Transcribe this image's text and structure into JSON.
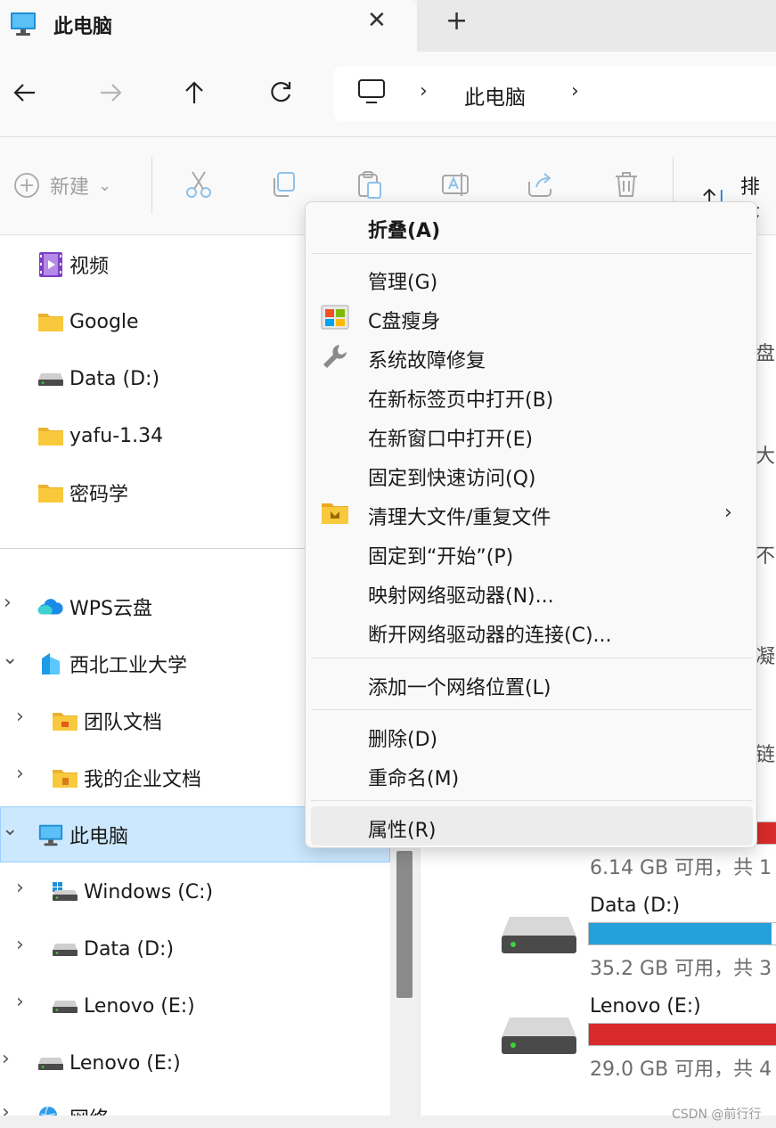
{
  "tab": {
    "title": "此电脑",
    "close_glyph": "✕",
    "new_glyph": "+"
  },
  "address": {
    "chevron": "›",
    "location": "此电脑"
  },
  "command_bar": {
    "new_label": "新建",
    "new_chevron": "⌄",
    "sort_label": "排序"
  },
  "nav_pane": {
    "quick_access": [
      {
        "label": "视频",
        "icon": "video-folder-icon"
      },
      {
        "label": "Google",
        "icon": "folder-icon"
      },
      {
        "label": "Data (D:)",
        "icon": "drive-icon"
      },
      {
        "label": "yafu-1.34",
        "icon": "folder-icon"
      },
      {
        "label": "密码学",
        "icon": "folder-icon"
      }
    ],
    "tree": [
      {
        "label": "WPS云盘",
        "icon": "cloud-icon",
        "chevron": "›"
      },
      {
        "label": "西北工业大学",
        "icon": "org-icon",
        "chevron": "⌄"
      },
      {
        "label": "团队文档",
        "icon": "team-folder-icon",
        "chevron": "›"
      },
      {
        "label": "我的企业文档",
        "icon": "enterprise-folder-icon",
        "chevron": "›"
      },
      {
        "label": "此电脑",
        "icon": "pc-icon",
        "chevron": "⌄"
      },
      {
        "label": "Windows (C:)",
        "icon": "windows-drive-icon",
        "chevron": "›"
      },
      {
        "label": "Data (D:)",
        "icon": "drive-icon",
        "chevron": "›"
      },
      {
        "label": "Lenovo  (E:)",
        "icon": "drive-icon",
        "chevron": "›"
      },
      {
        "label": "Lenovo  (E:)",
        "icon": "drive-icon",
        "chevron": "›"
      },
      {
        "label": "网络",
        "icon": "network-icon",
        "chevron": "›"
      }
    ]
  },
  "content": {
    "fragments": [
      "盘",
      "大",
      "不",
      "凝",
      "链"
    ],
    "drives": [
      {
        "space": "6.14 GB 可用，共 1",
        "bar_color": "#d92b2b",
        "fill": 0.97
      },
      {
        "name": "Data (D:)",
        "space": "35.2 GB 可用，共 3",
        "bar_color": "#26a0da",
        "fill": 0.9
      },
      {
        "name": "Lenovo  (E:)",
        "space": "29.0 GB 可用，共 4",
        "bar_color": "#d92b2b",
        "fill": 0.95
      }
    ]
  },
  "context_menu": {
    "items": [
      {
        "label": "折叠(A)",
        "bold": true
      },
      {
        "label": "管理(G)"
      },
      {
        "label": "C盘瘦身",
        "icon": "windows-logo-icon"
      },
      {
        "label": "系统故障修复",
        "icon": "wrench-icon"
      },
      {
        "label": "在新标签页中打开(B)"
      },
      {
        "label": "在新窗口中打开(E)"
      },
      {
        "label": "固定到快速访问(Q)"
      },
      {
        "label": "清理大文件/重复文件",
        "icon": "cleanup-folder-icon",
        "submenu": "›"
      },
      {
        "label": "固定到“开始”(P)"
      },
      {
        "label": "映射网络驱动器(N)..."
      },
      {
        "label": "断开网络驱动器的连接(C)..."
      },
      {
        "label": "添加一个网络位置(L)"
      },
      {
        "label": "删除(D)"
      },
      {
        "label": "重命名(M)"
      },
      {
        "label": "属性(R)"
      }
    ]
  },
  "watermark": "CSDN @前行行",
  "colors": {
    "selection": "#cce8ff",
    "selection_border": "#99d1ff",
    "accent_blue": "#26a0da",
    "danger_red": "#d92b2b",
    "folder_yellow": "#f8c93c"
  }
}
